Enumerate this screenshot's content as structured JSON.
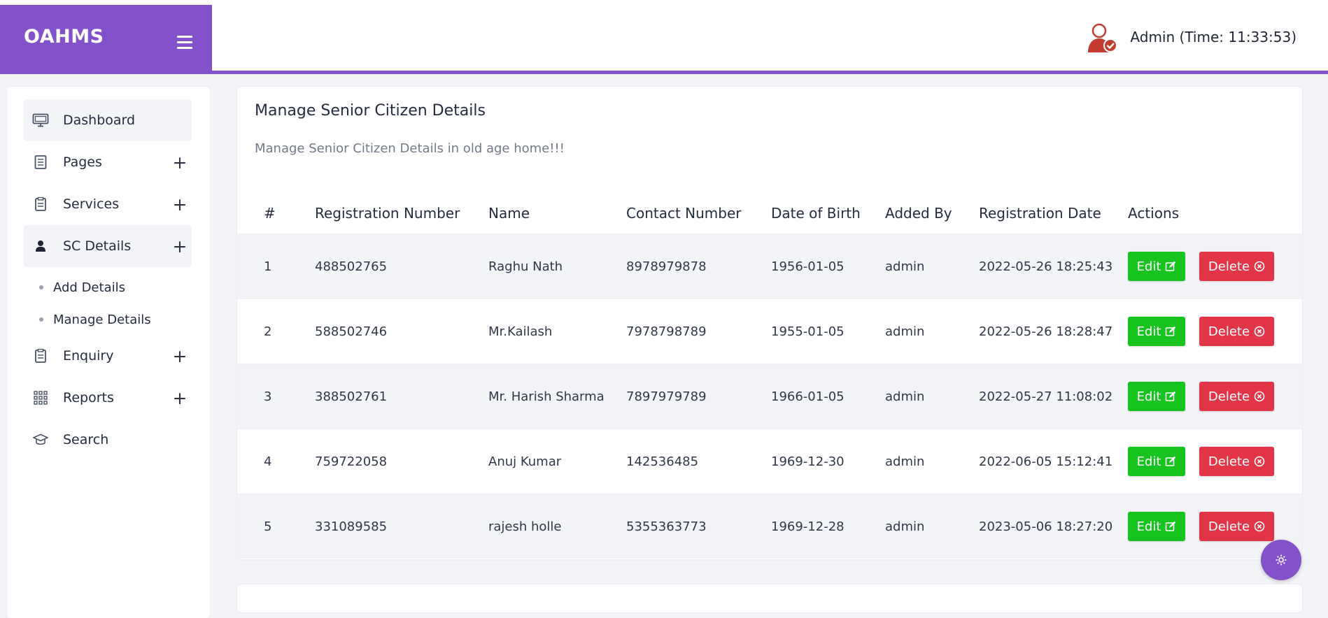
{
  "brand": {
    "title": "OAHMS"
  },
  "header": {
    "user_label": "Admin (Time: 11:33:53)"
  },
  "sidebar": {
    "items": [
      {
        "label": "Dashboard",
        "icon": "monitor-icon"
      },
      {
        "label": "Pages",
        "icon": "document-icon"
      },
      {
        "label": "Services",
        "icon": "clipboard-icon"
      },
      {
        "label": "SC Details",
        "icon": "user-icon"
      },
      {
        "label": "Enquiry",
        "icon": "clipboard-icon"
      },
      {
        "label": "Reports",
        "icon": "grid-icon"
      },
      {
        "label": "Search",
        "icon": "graduation-cap-icon"
      }
    ],
    "subitems": [
      {
        "label": "Add Details"
      },
      {
        "label": "Manage Details"
      }
    ]
  },
  "main": {
    "title": "Manage Senior Citizen Details",
    "subtitle": "Manage Senior Citizen Details in old age home!!!",
    "columns": [
      "#",
      "Registration Number",
      "Name",
      "Contact Number",
      "Date of Birth",
      "Added By",
      "Registration Date",
      "Actions"
    ],
    "rows": [
      {
        "num": "1",
        "reg": "488502765",
        "name": "Raghu Nath",
        "contact": "8978979878",
        "dob": "1956-01-05",
        "added_by": "admin",
        "reg_date": "2022-05-26 18:25:43"
      },
      {
        "num": "2",
        "reg": "588502746",
        "name": "Mr.Kailash",
        "contact": "7978798789",
        "dob": "1955-01-05",
        "added_by": "admin",
        "reg_date": "2022-05-26 18:28:47"
      },
      {
        "num": "3",
        "reg": "388502761",
        "name": "Mr. Harish Sharma",
        "contact": "7897979789",
        "dob": "1966-01-05",
        "added_by": "admin",
        "reg_date": "2022-05-27 11:08:02"
      },
      {
        "num": "4",
        "reg": "759722058",
        "name": "Anuj Kumar",
        "contact": "142536485",
        "dob": "1969-12-30",
        "added_by": "admin",
        "reg_date": "2022-06-05 15:12:41"
      },
      {
        "num": "5",
        "reg": "331089585",
        "name": "rajesh holle",
        "contact": "5355363773",
        "dob": "1969-12-28",
        "added_by": "admin",
        "reg_date": "2023-05-06 18:27:20"
      }
    ],
    "edit_label": "Edit",
    "delete_label": "Delete"
  },
  "colors": {
    "accent": "#8351c9",
    "edit": "#16c31f",
    "delete": "#e23648"
  }
}
